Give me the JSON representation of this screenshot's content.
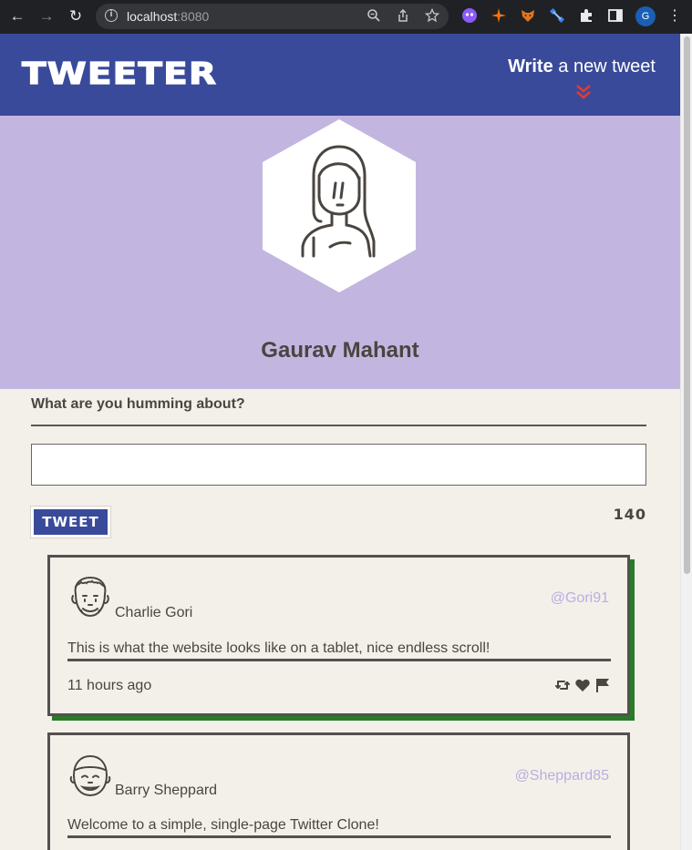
{
  "browser": {
    "url_host": "localhost",
    "url_port": ":8080",
    "profile_initial": "G",
    "icons": {
      "back": "arrow-left-icon",
      "forward": "arrow-right-icon",
      "reload": "reload-icon",
      "info": "info-icon",
      "zoom": "zoom-icon",
      "share": "share-icon",
      "bookmark": "star-icon",
      "extensions": "puzzle-icon",
      "sidepanel": "sidepanel-icon",
      "menu": "kebab-menu-icon"
    }
  },
  "header": {
    "brand": "TWEETER",
    "write_bold": "Write",
    "write_rest": " a new tweet",
    "chevron_color": "#e03b2f",
    "background": "#3a4a9a"
  },
  "profile": {
    "name": "Gaurav Mahant",
    "band_color": "#c2b6e0"
  },
  "compose": {
    "label": "What are you humming about?",
    "textarea_value": "",
    "button_label": "TWEET",
    "counter": "140"
  },
  "tweets": [
    {
      "name": "Charlie Gori",
      "handle": "@Gori91",
      "text": "This is what the website looks like on a tablet, nice endless scroll!",
      "time": "11 hours ago",
      "highlighted": true
    },
    {
      "name": "Barry Sheppard",
      "handle": "@Sheppard85",
      "text": "Welcome to a simple, single-page Twitter Clone!",
      "time": "",
      "highlighted": false
    }
  ]
}
